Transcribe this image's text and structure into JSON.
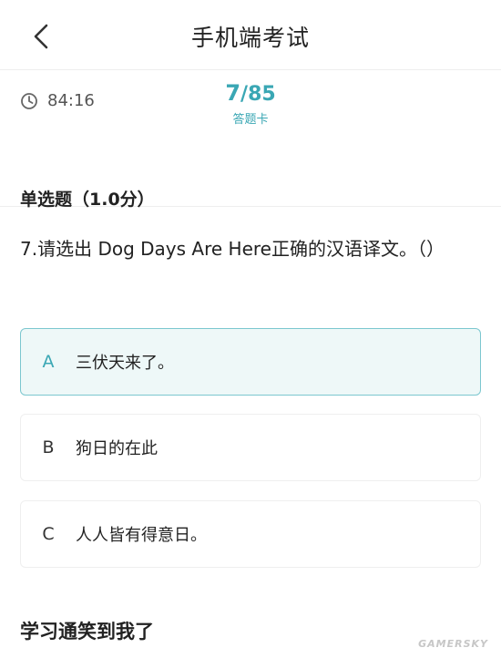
{
  "nav": {
    "title": "手机端考试",
    "back_icon": "chevron-left-icon"
  },
  "status": {
    "timer_icon": "clock-icon",
    "timer": "84:16",
    "current": "7",
    "separator": "/",
    "total": "85",
    "answer_card_label": "答题卡"
  },
  "question": {
    "type_label": "单选题（1.0分）",
    "text": "7.请选出 Dog Days Are Here正确的汉语译文。（）",
    "selected": "A",
    "options": [
      {
        "letter": "A",
        "text": "三伏天来了。"
      },
      {
        "letter": "B",
        "text": "狗日的在此"
      },
      {
        "letter": "C",
        "text": "人人皆有得意日。"
      }
    ]
  },
  "caption": "学习通笑到我了",
  "watermark": "GAMERSKY",
  "colors": {
    "accent": "#3aa7b4",
    "selected_bg": "#eef8f8",
    "selected_border": "#7cc7cf"
  }
}
